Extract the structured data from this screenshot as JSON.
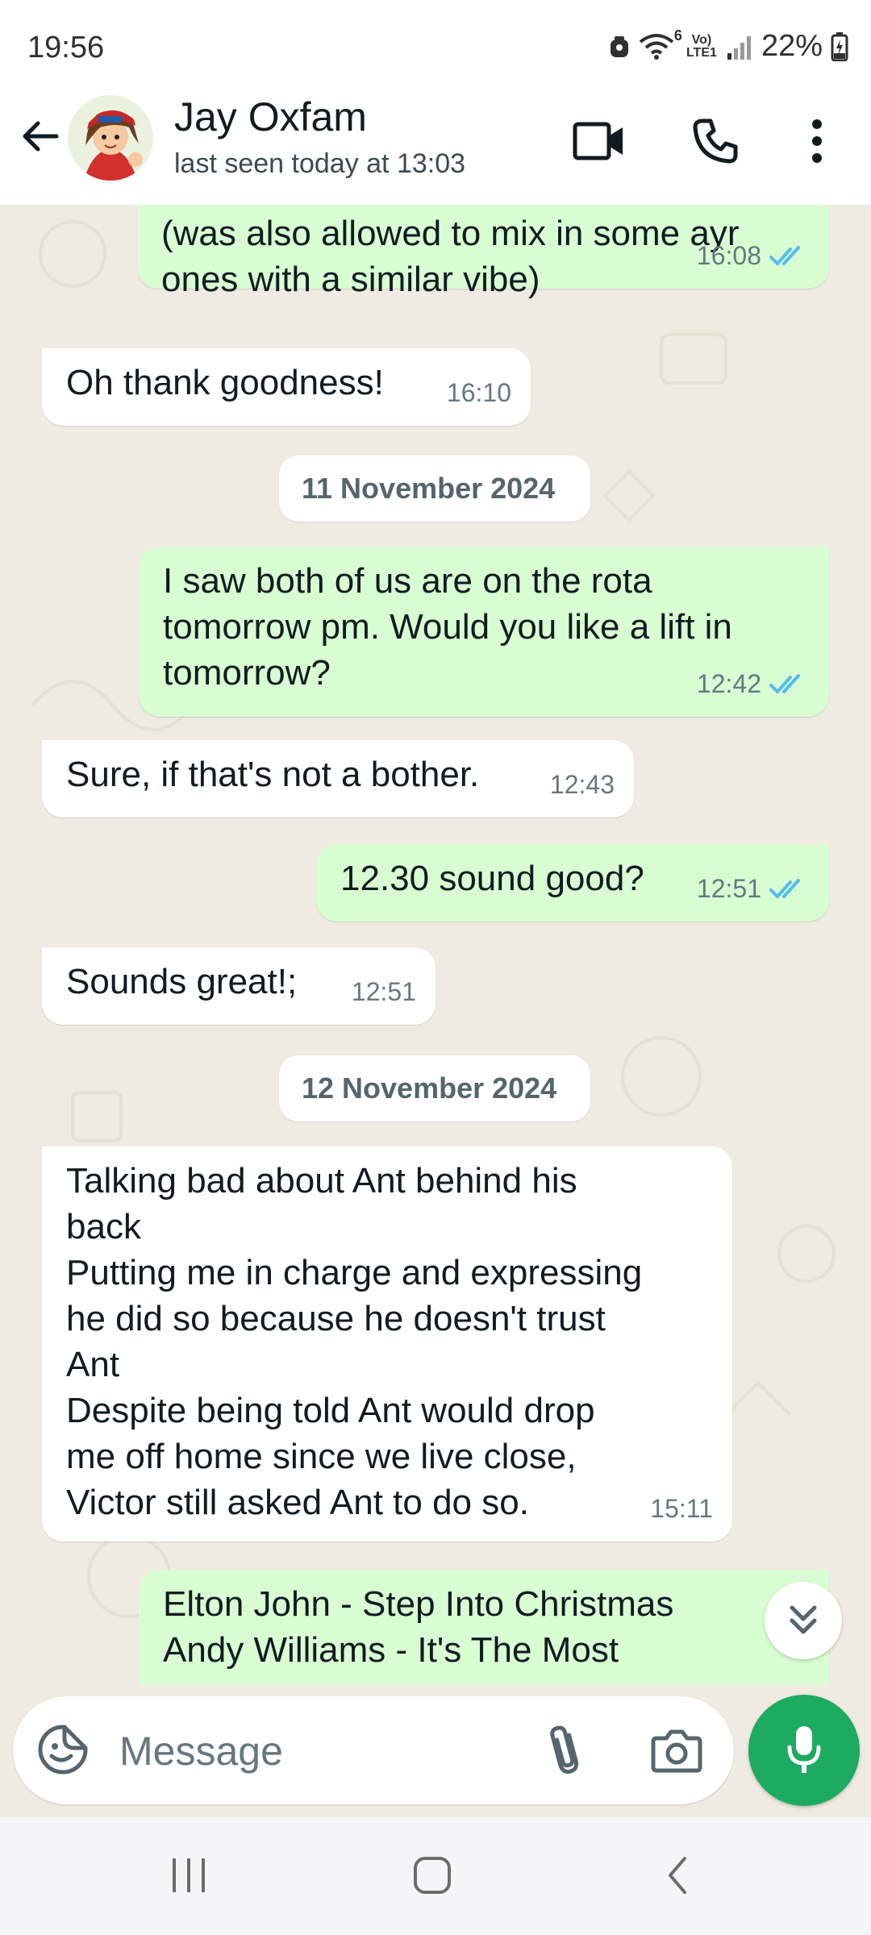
{
  "status_bar": {
    "time": "19:56",
    "network_label": "Vo) LTE1",
    "wifi_label": "6",
    "battery": "22%"
  },
  "header": {
    "contact_name": "Jay Oxfam",
    "last_seen": "last seen today at 13:03",
    "icons": [
      "back-arrow-icon",
      "video-call-icon",
      "phone-icon",
      "more-options-icon"
    ]
  },
  "messages": [
    {
      "kind": "out",
      "text": "(was also allowed to mix in some ayr\nones with a similar vibe)",
      "time": "16:08",
      "status": "read"
    },
    {
      "kind": "in",
      "text": "Oh thank goodness!",
      "time": "16:10"
    },
    {
      "kind": "date",
      "text": "11 November 2024"
    },
    {
      "kind": "out",
      "text": "I saw both of us are on the rota\ntomorrow pm. Would you like a lift in\ntomorrow?",
      "time": "12:42",
      "status": "read"
    },
    {
      "kind": "in",
      "text": "Sure, if that's not a bother.",
      "time": "12:43"
    },
    {
      "kind": "out",
      "text": "12.30 sound good?",
      "time": "12:51",
      "status": "read"
    },
    {
      "kind": "in",
      "text": "Sounds great!;",
      "time": "12:51"
    },
    {
      "kind": "date",
      "text": "12 November 2024"
    },
    {
      "kind": "in",
      "text": "Talking bad about Ant behind his\nback\nPutting me in charge and expressing\nhe did so because he doesn't trust\nAnt\nDespite being told Ant would drop\nme off home since we live close,\nVictor still asked Ant to do so.",
      "time": "15:11"
    },
    {
      "kind": "out",
      "text": "Elton John  -  Step Into Christmas\nAndy Williams  -  It's The Most",
      "time": "",
      "status": ""
    }
  ],
  "composer": {
    "placeholder": "Message",
    "value": ""
  },
  "colors": {
    "outgoing_bubble": "#d9fdd3",
    "incoming_bubble": "#ffffff",
    "chat_background": "#efeae2",
    "accent_green": "#1daa61",
    "read_ticks": "#53bdeb"
  }
}
